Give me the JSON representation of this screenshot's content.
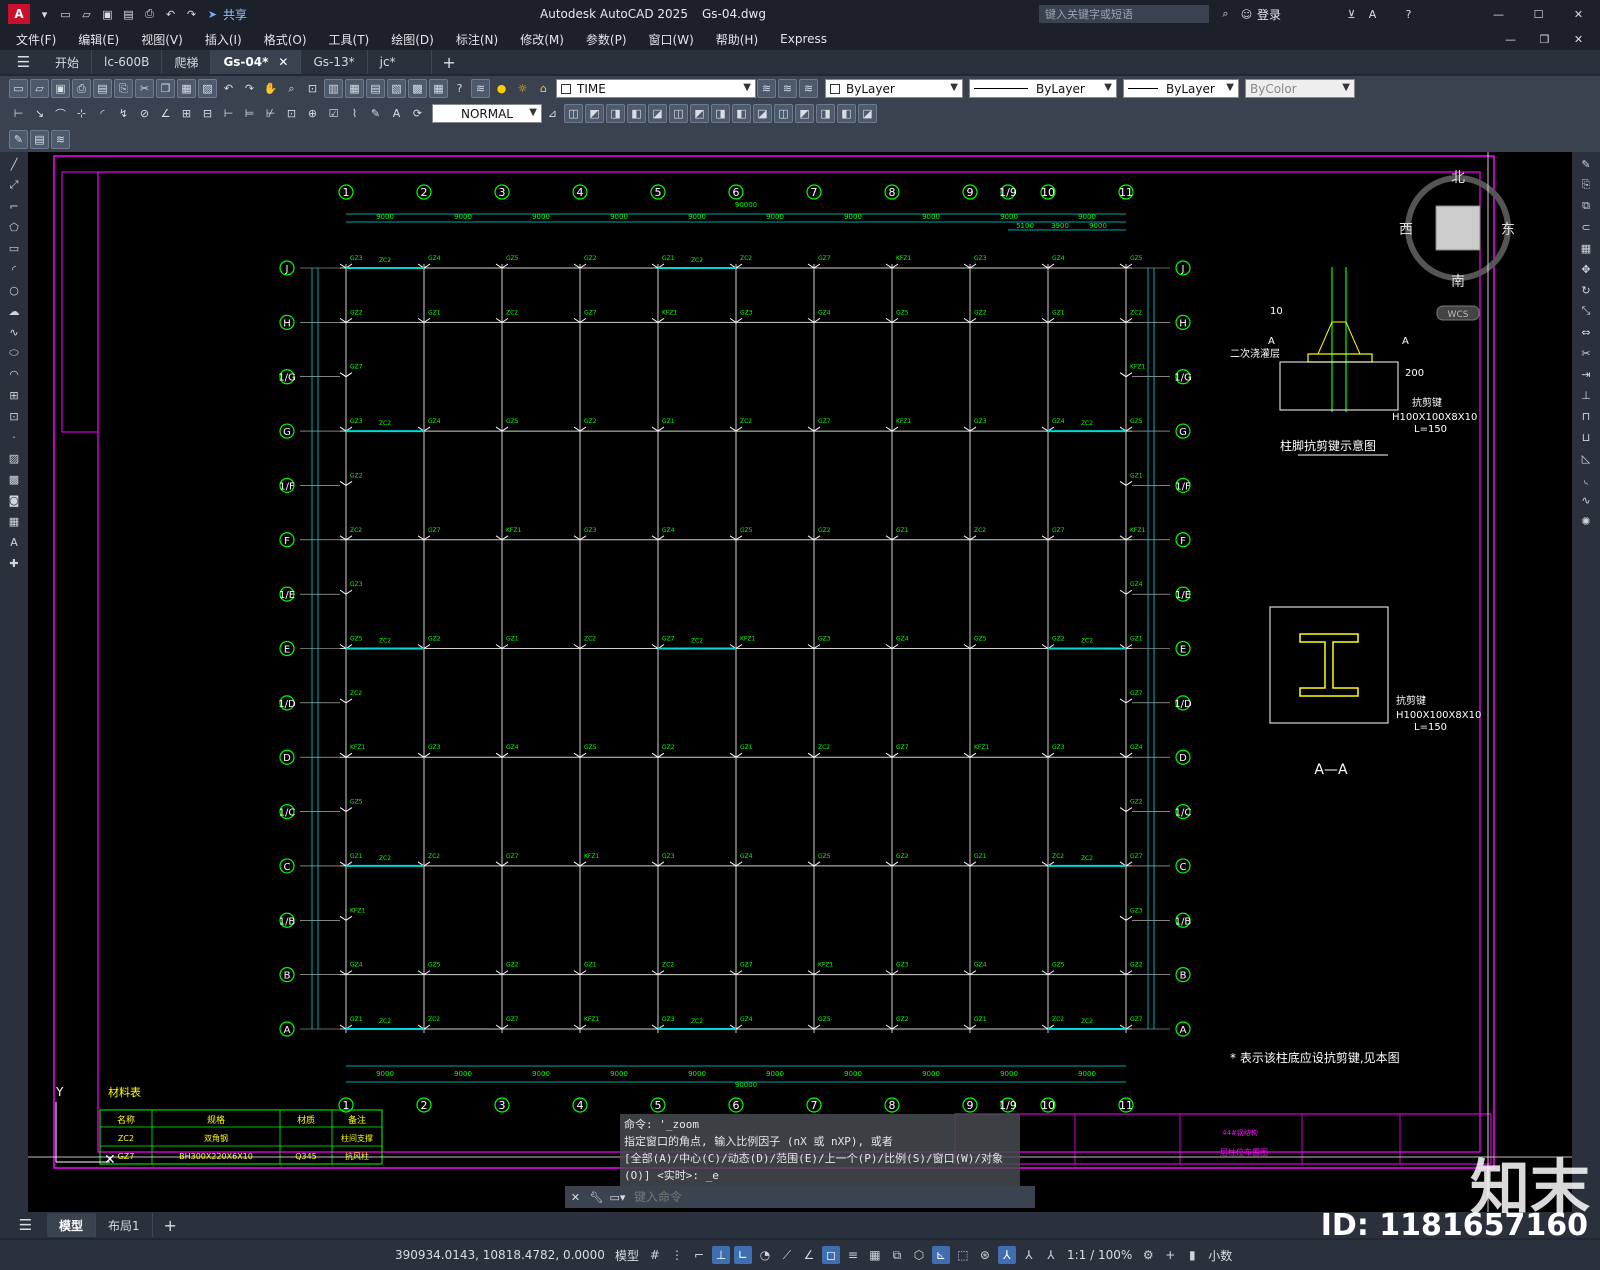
{
  "title": {
    "app": "Autodesk AutoCAD 2025",
    "file": "Gs-04.dwg",
    "share": "共享",
    "search_placeholder": "键入关键字或短语",
    "login": "登录"
  },
  "menu": [
    "文件(F)",
    "编辑(E)",
    "视图(V)",
    "插入(I)",
    "格式(O)",
    "工具(T)",
    "绘图(D)",
    "标注(N)",
    "修改(M)",
    "参数(P)",
    "窗口(W)",
    "帮助(H)",
    "Express"
  ],
  "tabs": [
    "开始",
    "lc-600B",
    "爬梯",
    "Gs-04*",
    "Gs-13*",
    "jc*"
  ],
  "toolbar": {
    "layer": "TIME",
    "bylayer1": "ByLayer",
    "bylayer2": "ByLayer",
    "bylayer3": "ByLayer",
    "bycolor": "ByColor",
    "textstyle": "NORMAL"
  },
  "compass": {
    "n": "北",
    "s": "南",
    "e": "东",
    "w": "西",
    "wcs": "WCS"
  },
  "drawing": {
    "axes_top": [
      "1",
      "2",
      "3",
      "4",
      "5",
      "6",
      "7",
      "8",
      "9",
      "1/9",
      "10",
      "11"
    ],
    "axes_left": [
      "J",
      "H",
      "1/G",
      "G",
      "1/F",
      "F",
      "1/E",
      "E",
      "1/D",
      "D",
      "1/C",
      "C",
      "1/B",
      "B",
      "A"
    ],
    "dim_span": "9000",
    "dim_total": "90000",
    "dim_top_right": [
      "5100",
      "3900",
      "9000"
    ],
    "detail1_title": "柱脚抗剪键示意图",
    "detail1_labels": [
      "10",
      "A",
      "A",
      "二次浇灌层",
      "抗剪键",
      "H100X100X8X10",
      "L=150",
      "200"
    ],
    "detail2_title": "A—A",
    "detail2_labels": [
      "抗剪键",
      "H100X100X8X10",
      "L=150"
    ],
    "note": "* 表示该柱底应设抗剪键,见本图",
    "table_title": "材料表",
    "table_header": [
      "名称",
      "规格",
      "材质",
      "备注"
    ],
    "table_rows": [
      [
        "ZC2",
        "双角钢",
        "",
        "柱间支撑"
      ],
      [
        "GZ7",
        "BH300X220X6X10",
        "Q345",
        "抗风柱"
      ]
    ],
    "titleblock": [
      "44#钢结构",
      "一层柱位布置图"
    ],
    "cell_labels": [
      "GZ3",
      "GZ4",
      "GZ5",
      "GZ2",
      "GZ1",
      "ZC2",
      "GZ7",
      "KFZ1"
    ]
  },
  "command": {
    "line1": "命令: '_zoom",
    "line2": "指定窗口的角点, 输入比例因子 (nX 或 nXP), 或者",
    "line3": "[全部(A)/中心(C)/动态(D)/范围(E)/上一个(P)/比例(S)/窗口(W)/对象",
    "line4": "(O)] <实时>: _e",
    "placeholder": "键入命令"
  },
  "layouts": [
    "模型",
    "布局1"
  ],
  "status": {
    "coords": "390934.0143, 10818.4782, 0.0000",
    "model": "模型",
    "scale": "1:1 / 100%",
    "units": "小数"
  },
  "watermark": {
    "brand": "知末",
    "id": "ID: 1181657160"
  },
  "colors": {
    "magenta": "#ff00ff",
    "green": "#00ff00",
    "cyan": "#00d8d8",
    "yellow": "#ffff00",
    "grid": "#d0d0d0"
  }
}
